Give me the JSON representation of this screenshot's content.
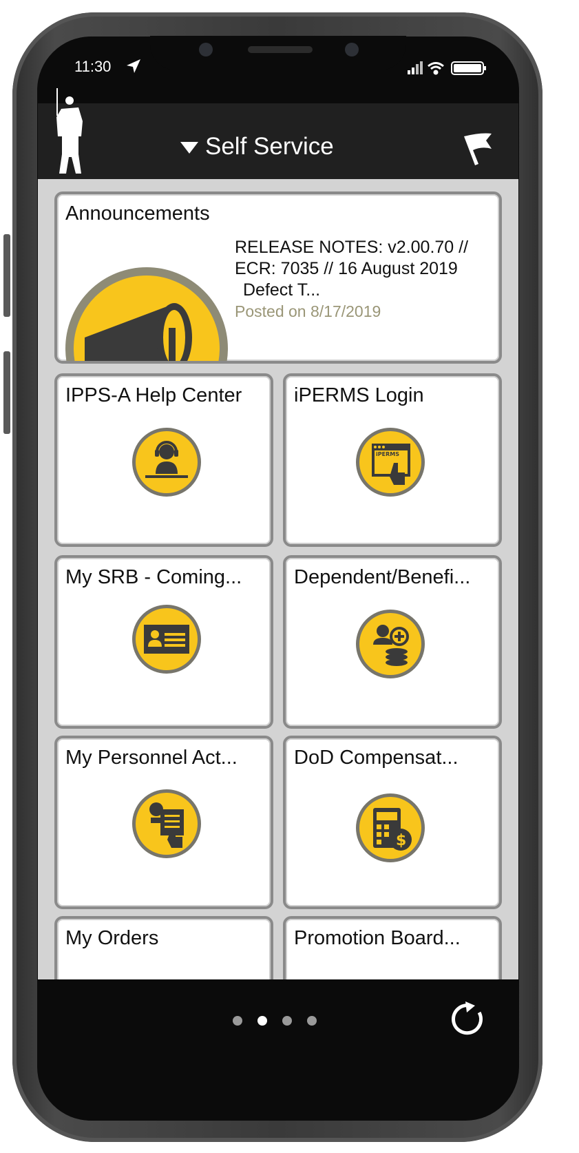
{
  "status_bar": {
    "time": "11:30"
  },
  "header": {
    "title": "Self Service"
  },
  "announcements": {
    "title": "Announcements",
    "text_line1": "RELEASE NOTES: v2.00.70 //",
    "text_line2": "ECR: 7035 // 16 August 2019",
    "text_line3": "Defect T...",
    "posted": "Posted on 8/17/2019"
  },
  "tiles": [
    {
      "label": "IPPS-A Help Center",
      "icon": "help-center-icon"
    },
    {
      "label": "iPERMS Login",
      "icon": "iperms-login-icon",
      "icon_text": "iPERMS"
    },
    {
      "label": "My SRB - Coming...",
      "icon": "srb-id-card-icon"
    },
    {
      "label": "Dependent/Benefi...",
      "icon": "dependent-benefits-icon"
    },
    {
      "label": "My Personnel Act...",
      "icon": "personnel-action-icon"
    },
    {
      "label": "DoD Compensat...",
      "icon": "compensation-calculator-icon"
    },
    {
      "label": "My Orders",
      "icon": ""
    },
    {
      "label": "Promotion Board...",
      "icon": ""
    }
  ],
  "pagination": {
    "pages": 4,
    "current": 2
  },
  "colors": {
    "accent_yellow": "#f8c51c",
    "header_bg": "#202020",
    "card_border": "#8a8a8a"
  }
}
